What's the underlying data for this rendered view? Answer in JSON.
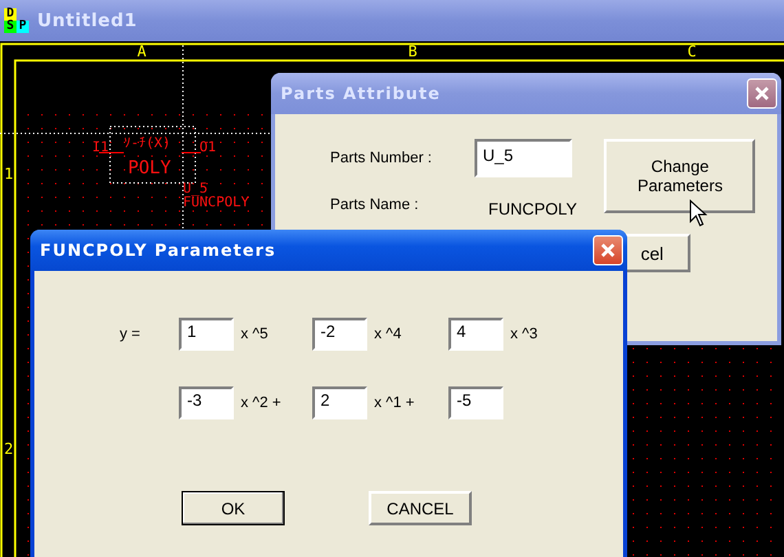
{
  "window": {
    "title": "Untitled1",
    "app_icon_letters": [
      "D",
      "S",
      "P"
    ]
  },
  "canvas": {
    "columns": [
      "A",
      "B",
      "C"
    ],
    "rows": [
      "1",
      "2"
    ],
    "part": {
      "pin_in": "I1",
      "pin_out": "O1",
      "symbol_text": "ｿ-ﾁ(X)",
      "name": "POLY",
      "ref": "U_5",
      "type": "FUNCPOLY"
    }
  },
  "parts_attribute": {
    "title": "Parts Attribute",
    "active": false,
    "number_label": "Parts Number :",
    "number_value": "U_5",
    "name_label": "Parts Name :",
    "name_value": "FUNCPOLY",
    "change_button": "Change Parameters",
    "cancel_fragment": "cel"
  },
  "funcpoly_parameters": {
    "title": "FUNCPOLY Parameters",
    "active": true,
    "lhs": "y =",
    "terms": [
      {
        "value": "1",
        "label": "x ^5"
      },
      {
        "value": "-2",
        "label": "x ^4"
      },
      {
        "value": "4",
        "label": "x ^3"
      },
      {
        "value": "-3",
        "label": "x ^2 +"
      },
      {
        "value": "2",
        "label": "x ^1 +"
      },
      {
        "value": "-5"
      }
    ],
    "buttons": [
      {
        "label": "OK",
        "default": true
      },
      {
        "label": "CANCEL",
        "default": false
      }
    ]
  }
}
